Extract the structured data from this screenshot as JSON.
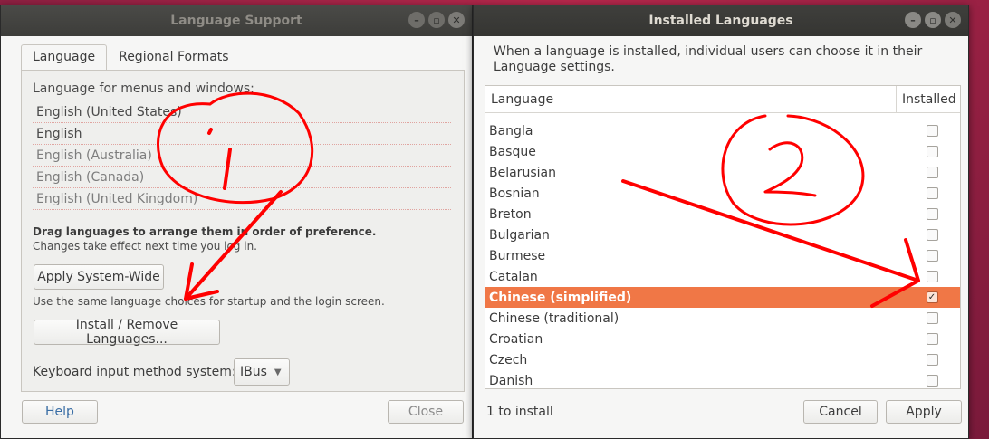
{
  "left_window": {
    "title": "Language Support",
    "tabs": [
      {
        "label": "Language"
      },
      {
        "label": "Regional Formats"
      }
    ],
    "caption": "Language for menus and windows:",
    "languages": [
      {
        "label": "English (United States)"
      },
      {
        "label": "English"
      },
      {
        "label": "English (Australia)"
      },
      {
        "label": "English (Canada)"
      },
      {
        "label": "English (United Kingdom)"
      }
    ],
    "drag_hint": "Drag languages to arrange them in order of preference.",
    "drag_hint_sub": "Changes take effect next time you log in.",
    "apply_system_wide": "Apply System-Wide",
    "apply_desc": "Use the same language choices for startup and the login screen.",
    "install_remove": "Install / Remove Languages...",
    "keyboard_label": "Keyboard input method system:",
    "keyboard_value": "IBus",
    "help": "Help",
    "close": "Close"
  },
  "right_window": {
    "title": "Installed Languages",
    "description": "When a language is installed, individual users can choose it in their Language settings.",
    "columns": {
      "language": "Language",
      "installed": "Installed"
    },
    "rows": [
      {
        "label": "Bangla",
        "checked": false,
        "selected": false
      },
      {
        "label": "Basque",
        "checked": false,
        "selected": false
      },
      {
        "label": "Belarusian",
        "checked": false,
        "selected": false
      },
      {
        "label": "Bosnian",
        "checked": false,
        "selected": false
      },
      {
        "label": "Breton",
        "checked": false,
        "selected": false
      },
      {
        "label": "Bulgarian",
        "checked": false,
        "selected": false
      },
      {
        "label": "Burmese",
        "checked": false,
        "selected": false
      },
      {
        "label": "Catalan",
        "checked": false,
        "selected": false
      },
      {
        "label": "Chinese (simplified)",
        "checked": true,
        "selected": true
      },
      {
        "label": "Chinese (traditional)",
        "checked": false,
        "selected": false
      },
      {
        "label": "Croatian",
        "checked": false,
        "selected": false
      },
      {
        "label": "Czech",
        "checked": false,
        "selected": false
      },
      {
        "label": "Danish",
        "checked": false,
        "selected": false
      }
    ],
    "status": "1 to install",
    "cancel": "Cancel",
    "apply": "Apply"
  },
  "colors": {
    "selection": "#f07746",
    "annotation": "#ff0000"
  }
}
